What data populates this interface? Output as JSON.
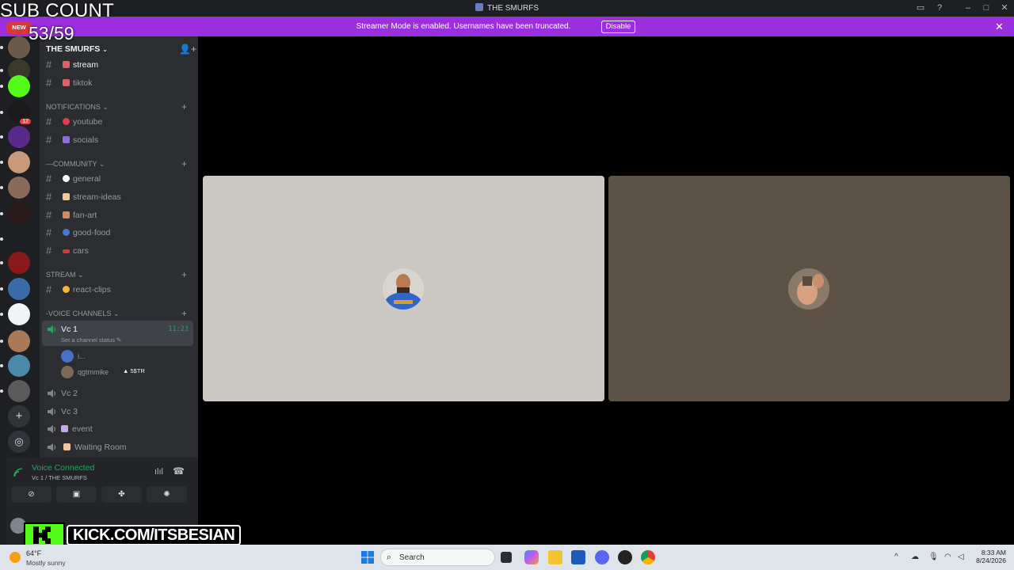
{
  "window": {
    "title": "THE SMURFS"
  },
  "banner": {
    "message": "Streamer Mode is enabled. Usernames have been truncated.",
    "disable_label": "Disable"
  },
  "overlay": {
    "sub_count_label": "SUB COUNT",
    "sub_count_value": "53/59",
    "new_badge": "NEW",
    "kick_url": "KICK.COM/ITSBESIAN"
  },
  "guild": {
    "name": "THE SMURFS"
  },
  "channels": {
    "top": [
      {
        "label": "stream",
        "emoji_color": "#e35d6a"
      },
      {
        "label": "tiktok",
        "emoji_color": "#e35d6a"
      }
    ],
    "notifications": {
      "label": "NOTIFICATIONS",
      "items": [
        {
          "label": "youtube",
          "emoji_color": "#e8394d"
        },
        {
          "label": "socials",
          "emoji_color": "#8b6fd6"
        }
      ]
    },
    "community": {
      "label": "—COMMUNITY",
      "items": [
        {
          "label": "general",
          "emoji_color": "#ffffff"
        },
        {
          "label": "stream-ideas",
          "emoji_color": "#f0c8a0"
        },
        {
          "label": "fan-art",
          "emoji_color": "#d78a5c"
        },
        {
          "label": "good-food",
          "emoji_color": "#4a78c8"
        },
        {
          "label": "cars",
          "emoji_color": "#d23a3a"
        }
      ]
    },
    "stream": {
      "label": "STREAM",
      "items": [
        {
          "label": "react-clips",
          "emoji_color": "#f5b53c"
        }
      ]
    },
    "voice": {
      "label": "-VOICE CHANNELS",
      "active": {
        "label": "Vc 1",
        "time": "11:23",
        "status": "Set a channel status"
      },
      "members": [
        {
          "name": "i...",
          "avatar_color": "#4a6fc8"
        },
        {
          "name": "qgtmmike",
          "avatar_color": "#7a6a58",
          "tag": "5$TR"
        }
      ],
      "others": [
        {
          "label": "Vc 2"
        },
        {
          "label": "Vc 3"
        },
        {
          "label": "event",
          "emoji_color": "#c8a8e8"
        },
        {
          "label": "Waiting Room",
          "emoji_color": "#f0c8a0"
        }
      ]
    }
  },
  "voice_panel": {
    "title": "Voice Connected",
    "subtitle": "Vc 1 / THE SMURFS"
  },
  "tiles": [
    {
      "bg": "#cbc7c2"
    },
    {
      "bg": "#5c5246"
    }
  ],
  "taskbar": {
    "weather_temp": "64°F",
    "weather_cond": "Mostly sunny",
    "search_placeholder": "Search",
    "time": "8:33 AM",
    "date": "8/24/2026"
  },
  "servers": [
    {
      "color": "#6b5a4a"
    },
    {
      "color": "#3a3a2a"
    },
    {
      "color": "#53fc18"
    },
    {
      "color": "#1a1a1a",
      "badge": "12"
    },
    {
      "color": "#5a2a8a"
    },
    {
      "color": "#c89a7a"
    },
    {
      "color": "#8a6a5a"
    },
    {
      "color": "#2a1a1a"
    },
    {
      "color": "#1e1f22"
    },
    {
      "color": "#8a1a1a"
    },
    {
      "color": "#3a6aa8"
    },
    {
      "color": "#f2f3f5"
    },
    {
      "color": "#a87a5a"
    },
    {
      "color": "#4a8aa8"
    },
    {
      "color": "#5a5a5a"
    }
  ]
}
